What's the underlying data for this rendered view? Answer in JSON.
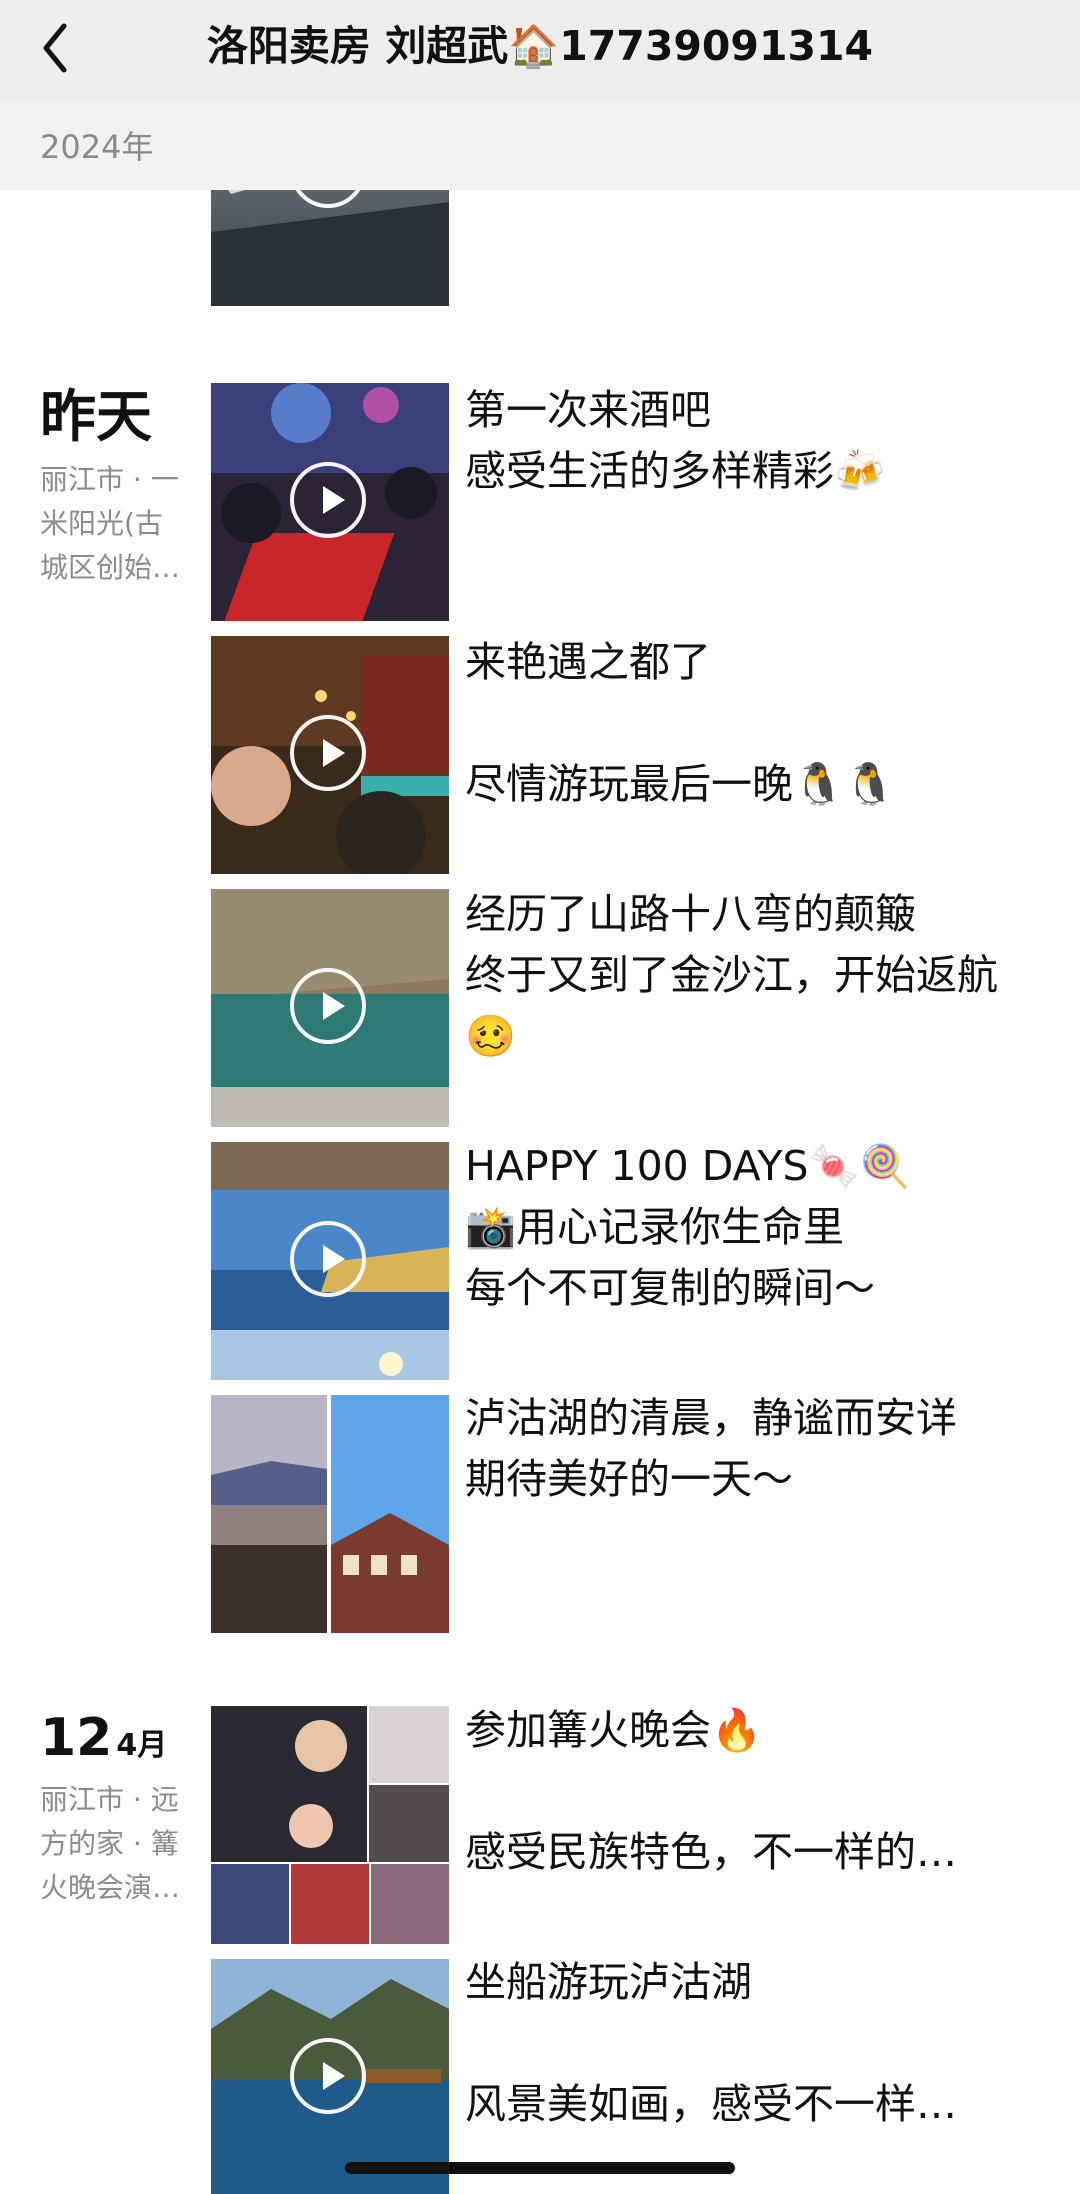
{
  "header": {
    "title": "洛阳卖房 刘超武🏠17739091314",
    "back_icon": "chevron-left-icon"
  },
  "year_label": "2024年",
  "days": [
    {
      "date_label": "昨天",
      "location": "丽江市 · 一米阳光(古城区创始…",
      "posts": [
        {
          "text": "第一次来酒吧\n感受生活的多样精彩🍻",
          "media": "video"
        },
        {
          "text": "来艳遇之都了\n\n尽情游玩最后一晚🐧🐧",
          "media": "video"
        },
        {
          "text": "经历了山路十八弯的颠簸\n终于又到了金沙江，开始返航🥴",
          "media": "video"
        },
        {
          "text": "HAPPY 100 DAYS🍬🍭\n📸用心记录你生命里\n每个不可复制的瞬间～",
          "media": "video"
        },
        {
          "text": "泸沽湖的清晨，静谧而安详\n期待美好的一天～",
          "media": "photos"
        }
      ]
    },
    {
      "date_day": "12",
      "date_month": "4月",
      "location": "丽江市 · 远方的家 · 篝火晚会演…",
      "posts": [
        {
          "text": "参加篝火晚会🔥\n\n感受民族特色，不一样的…",
          "media": "photo-grid"
        },
        {
          "text": "坐船游玩泸沽湖\n\n风景美如画，感受不一样…",
          "media": "video"
        }
      ]
    }
  ]
}
